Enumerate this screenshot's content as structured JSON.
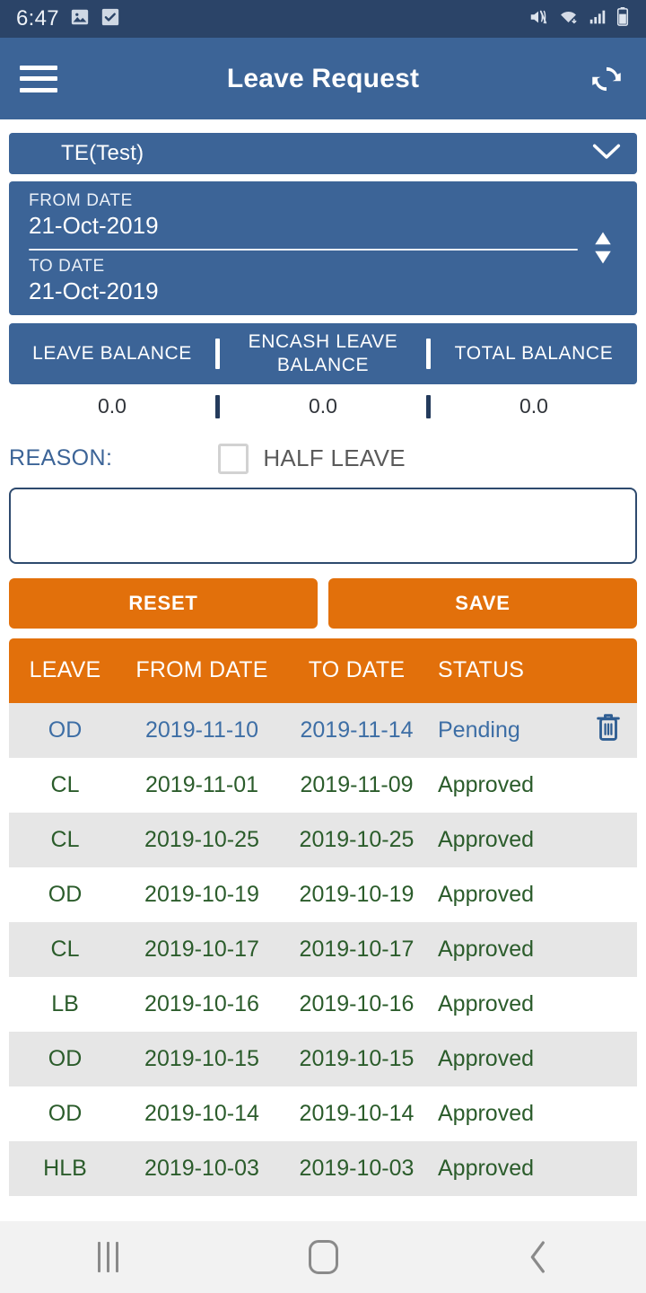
{
  "status_bar": {
    "time": "6:47",
    "left_icons": [
      "image-icon",
      "task-complete-icon"
    ],
    "right_icons": [
      "mute-vibrate-icon",
      "wifi-icon",
      "cellular-signal-icon",
      "battery-icon"
    ]
  },
  "app_bar": {
    "menu_icon": "hamburger-menu-icon",
    "title": "Leave Request",
    "refresh_icon": "refresh-icon"
  },
  "leave_type_select": {
    "value": "TE(Test)",
    "chevron_icon": "chevron-down-icon"
  },
  "date_range": {
    "from_label": "FROM DATE",
    "from_value": "21-Oct-2019",
    "to_label": "TO DATE",
    "to_value": "21-Oct-2019",
    "stepper_icon": "up-down-arrows-icon"
  },
  "balances": {
    "headers": [
      "LEAVE BALANCE",
      "ENCASH LEAVE BALANCE",
      "TOTAL BALANCE"
    ],
    "values": [
      "0.0",
      "0.0",
      "0.0"
    ]
  },
  "reason": {
    "label": "REASON:",
    "half_leave_label": "HALF LEAVE",
    "half_leave_checked": false,
    "text_value": "",
    "placeholder": ""
  },
  "actions": {
    "reset_label": "RESET",
    "save_label": "SAVE"
  },
  "table": {
    "headers": [
      "LEAVE",
      "FROM DATE",
      "TO DATE",
      "STATUS"
    ],
    "rows": [
      {
        "leave": "OD",
        "from": "2019-11-10",
        "to": "2019-11-14",
        "status": "Pending",
        "has_delete": true,
        "delete_icon": "trash-icon"
      },
      {
        "leave": "CL",
        "from": "2019-11-01",
        "to": "2019-11-09",
        "status": "Approved",
        "has_delete": false,
        "delete_icon": ""
      },
      {
        "leave": "CL",
        "from": "2019-10-25",
        "to": "2019-10-25",
        "status": "Approved",
        "has_delete": false,
        "delete_icon": ""
      },
      {
        "leave": "OD",
        "from": "2019-10-19",
        "to": "2019-10-19",
        "status": "Approved",
        "has_delete": false,
        "delete_icon": ""
      },
      {
        "leave": "CL",
        "from": "2019-10-17",
        "to": "2019-10-17",
        "status": "Approved",
        "has_delete": false,
        "delete_icon": ""
      },
      {
        "leave": "LB",
        "from": "2019-10-16",
        "to": "2019-10-16",
        "status": "Approved",
        "has_delete": false,
        "delete_icon": ""
      },
      {
        "leave": "OD",
        "from": "2019-10-15",
        "to": "2019-10-15",
        "status": "Approved",
        "has_delete": false,
        "delete_icon": ""
      },
      {
        "leave": "OD",
        "from": "2019-10-14",
        "to": "2019-10-14",
        "status": "Approved",
        "has_delete": false,
        "delete_icon": ""
      },
      {
        "leave": "HLB",
        "from": "2019-10-03",
        "to": "2019-10-03",
        "status": "Approved",
        "has_delete": false,
        "delete_icon": ""
      }
    ]
  },
  "nav_bar": {
    "recents_icon": "recents-icon",
    "home_icon": "home-icon",
    "back_icon": "back-chevron-icon"
  },
  "colors": {
    "status_bar_bg": "#2b4468",
    "app_bar_bg": "#3c6497",
    "accent_orange": "#e2700b",
    "approved_green": "#2b5c2b",
    "pending_blue": "#3d6ea5",
    "row_alt_bg": "#e6e6e6"
  }
}
